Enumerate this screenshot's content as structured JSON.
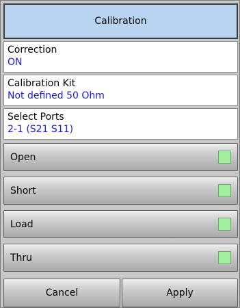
{
  "title": "Calibration",
  "correction": {
    "label": "Correction",
    "value": "ON"
  },
  "calibration_kit": {
    "label": "Calibration Kit",
    "value": "Not defined 50 Ohm"
  },
  "select_ports": {
    "label": "Select Ports",
    "value": "2-1 (S21 S11)"
  },
  "standards": [
    {
      "label": "Open"
    },
    {
      "label": "Short"
    },
    {
      "label": "Load"
    },
    {
      "label": "Thru"
    }
  ],
  "footer": {
    "cancel_label": "Cancel",
    "apply_label": "Apply"
  },
  "colors": {
    "title_bg": "#b9d4f1",
    "value_text": "#1a1ad8",
    "indicator": "#a0f0a0"
  }
}
